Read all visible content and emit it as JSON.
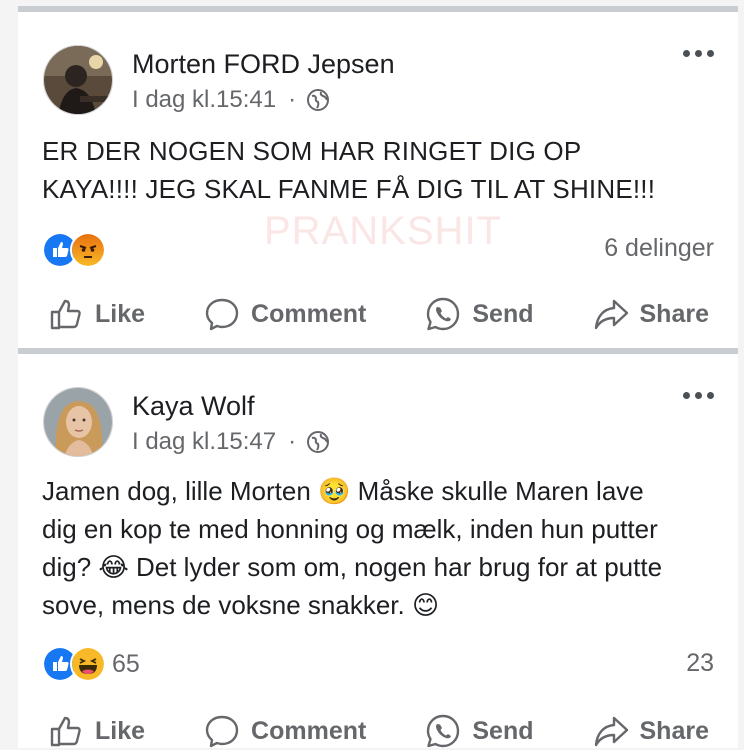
{
  "posts": [
    {
      "author": "Morten FORD Jepsen",
      "timestamp": "I dag kl.15:41",
      "separator": "·",
      "audience_icon": "globe-icon",
      "text_lines": [
        "ER DER NOGEN SOM HAR RINGET DIG OP",
        "KAYA!!!! JEG SKAL FANME FÅ DIG TIL AT SHINE!!!"
      ],
      "watermark": "PRANKSHIT",
      "reactions": [
        "like",
        "angry"
      ],
      "reaction_count": "",
      "shares": "6 delinger"
    },
    {
      "author": "Kaya Wolf",
      "timestamp": "I dag kl.15:47",
      "separator": "·",
      "audience_icon": "globe-icon",
      "text_lines": [
        "Jamen dog, lille Morten 🥹 Måske skulle Maren lave",
        "dig en kop te med honning og mælk, inden hun putter",
        "dig? 😂 Det lyder som om, nogen har brug for at putte",
        "sove, mens de voksne snakker. 😊"
      ],
      "reactions": [
        "like",
        "haha"
      ],
      "reaction_count": "65",
      "shares": "23"
    }
  ],
  "actions": {
    "like": "Like",
    "comment": "Comment",
    "send": "Send",
    "share": "Share"
  },
  "colors": {
    "like_blue": "#1877f2",
    "angry_orange": "#e9710f",
    "haha_yellow": "#f7b928",
    "muted_text": "#65676b"
  }
}
